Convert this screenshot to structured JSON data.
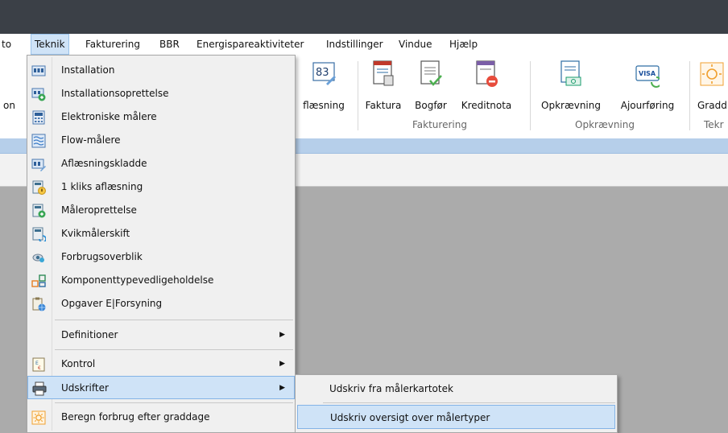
{
  "menubar": {
    "items": [
      {
        "label": "to"
      },
      {
        "label": "Teknik"
      },
      {
        "label": "Fakturering"
      },
      {
        "label": "BBR"
      },
      {
        "label": "Energispareaktiviteter"
      },
      {
        "label": "Indstillinger"
      },
      {
        "label": "Vindue"
      },
      {
        "label": "Hjælp"
      }
    ]
  },
  "ribbon": {
    "left_partial_label": "on",
    "buttons": [
      {
        "label": "flæsning",
        "icon": "meter-reading-icon"
      },
      {
        "label": "Faktura",
        "icon": "invoice-icon"
      },
      {
        "label": "Bogfør",
        "icon": "post-ledger-icon"
      },
      {
        "label": "Kreditnota",
        "icon": "credit-note-icon"
      },
      {
        "label": "Opkrævning",
        "icon": "collection-icon"
      },
      {
        "label": "Ajourføring",
        "icon": "visa-card-icon"
      },
      {
        "label": "Gradd",
        "icon": "sun-icon"
      }
    ],
    "groups": [
      {
        "label": "Fakturering"
      },
      {
        "label": "Opkrævning"
      },
      {
        "label": "Tekr"
      }
    ],
    "visa_text": "VISA",
    "reading_digits": "83"
  },
  "teknik_menu": {
    "items": [
      {
        "label": "Installation",
        "icon": "installation-icon"
      },
      {
        "label": "Installationsoprettelse",
        "icon": "installation-create-icon"
      },
      {
        "label": "Elektroniske målere",
        "icon": "electronic-meter-icon"
      },
      {
        "label": "Flow-målere",
        "icon": "flow-meter-icon"
      },
      {
        "label": "Aflæsningskladde",
        "icon": "reading-draft-icon"
      },
      {
        "label": "1 kliks aflæsning",
        "icon": "one-click-reading-icon"
      },
      {
        "label": "Måleroprettelse",
        "icon": "meter-create-icon"
      },
      {
        "label": "Kvikmålerskift",
        "icon": "quick-meter-change-icon"
      },
      {
        "label": "Forbrugsoverblik",
        "icon": "consumption-overview-icon"
      },
      {
        "label": "Komponenttypevedligeholdelse",
        "icon": "component-types-icon"
      },
      {
        "label": "Opgaver E|Forsyning",
        "icon": "tasks-globe-icon"
      },
      {
        "label": "Definitioner",
        "icon": ""
      },
      {
        "label": "Kontrol",
        "icon": "control-icon"
      },
      {
        "label": "Udskrifter",
        "icon": "printer-icon"
      },
      {
        "label": "Beregn forbrug efter graddage",
        "icon": "sun-icon"
      }
    ],
    "submenu_arrow": "▶"
  },
  "udskrifter_submenu": {
    "items": [
      {
        "label": "Udskriv fra målerkartotek"
      },
      {
        "label": "Udskriv oversigt over målertyper"
      }
    ]
  },
  "colors": {
    "titlebar": "#3b4047",
    "highlight": "#cfe3f7",
    "band": "#b6cfea",
    "workspace": "#ababab"
  }
}
